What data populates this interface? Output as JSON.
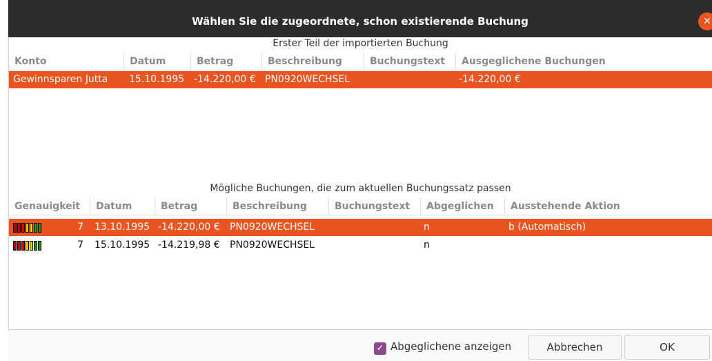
{
  "dialog": {
    "title": "Wählen Sie die zugeordnete, schon existierende Buchung",
    "close_glyph": "✕"
  },
  "imported": {
    "caption": "Erster Teil der importierten Buchung",
    "columns": [
      "Konto",
      "Datum",
      "Betrag",
      "Beschreibung",
      "Buchungstext",
      "Ausgeglichene Buchungen"
    ],
    "rows": [
      {
        "konto": "Gewinnsparen Jutta",
        "datum": "15.10.1995",
        "betrag": "-14.220,00 €",
        "beschreibung": "PN0920WECHSEL",
        "buchungstext": "",
        "ausgeglichen": "-14.220,00 €",
        "selected": true
      }
    ]
  },
  "matches": {
    "caption": "Mögliche Buchungen, die zum aktuellen Buchungssatz passen",
    "columns": [
      "Genauigkeit",
      "Datum",
      "Betrag",
      "Beschreibung",
      "Buchungstext",
      "Abgeglichen",
      "Ausstehende Aktion"
    ],
    "rows": [
      {
        "score": "7",
        "datum": "13.10.1995",
        "betrag": "-14.220,00 €",
        "beschreibung": "PN0920WECHSEL",
        "buchungstext": "",
        "abgeglichen": "n",
        "aktion": "b (Automatisch)",
        "selected": true
      },
      {
        "score": "7",
        "datum": "15.10.1995",
        "betrag": "-14.219,98 €",
        "beschreibung": "PN0920WECHSEL",
        "buchungstext": "",
        "abgeglichen": "n",
        "aktion": "",
        "selected": false
      }
    ],
    "accuracy_bar_colors": [
      "#b00000",
      "#c80000",
      "#d40000",
      "#e8c000",
      "#f0d800",
      "#2a9a2a",
      "#1f8f1f"
    ]
  },
  "footer": {
    "checkbox_label": "Abgeglichene anzeigen",
    "checkbox_checked": true,
    "checkbox_glyph": "✓",
    "cancel_label": "Abbrechen",
    "ok_label": "OK"
  },
  "colors": {
    "accent": "#e95420",
    "titlebar": "#2c2c2c",
    "checkbox": "#8b4a8b"
  }
}
